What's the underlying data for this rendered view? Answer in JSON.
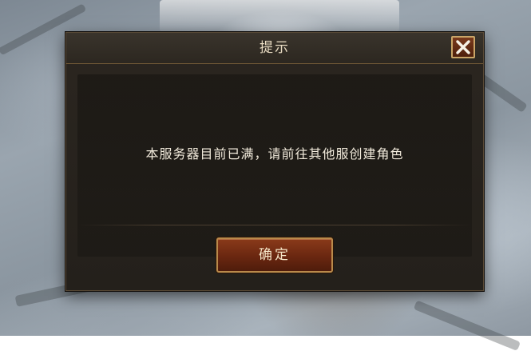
{
  "dialog": {
    "title": "提示",
    "message": "本服务器目前已满，请前往其他服创建角色",
    "confirm_label": "确定",
    "close_icon": "close-icon"
  },
  "colors": {
    "title_text": "#e9dcc3",
    "message_text": "#f1eadb",
    "button_fill": "#6a2710",
    "button_border": "#b98a4b",
    "close_border": "#caa567"
  }
}
